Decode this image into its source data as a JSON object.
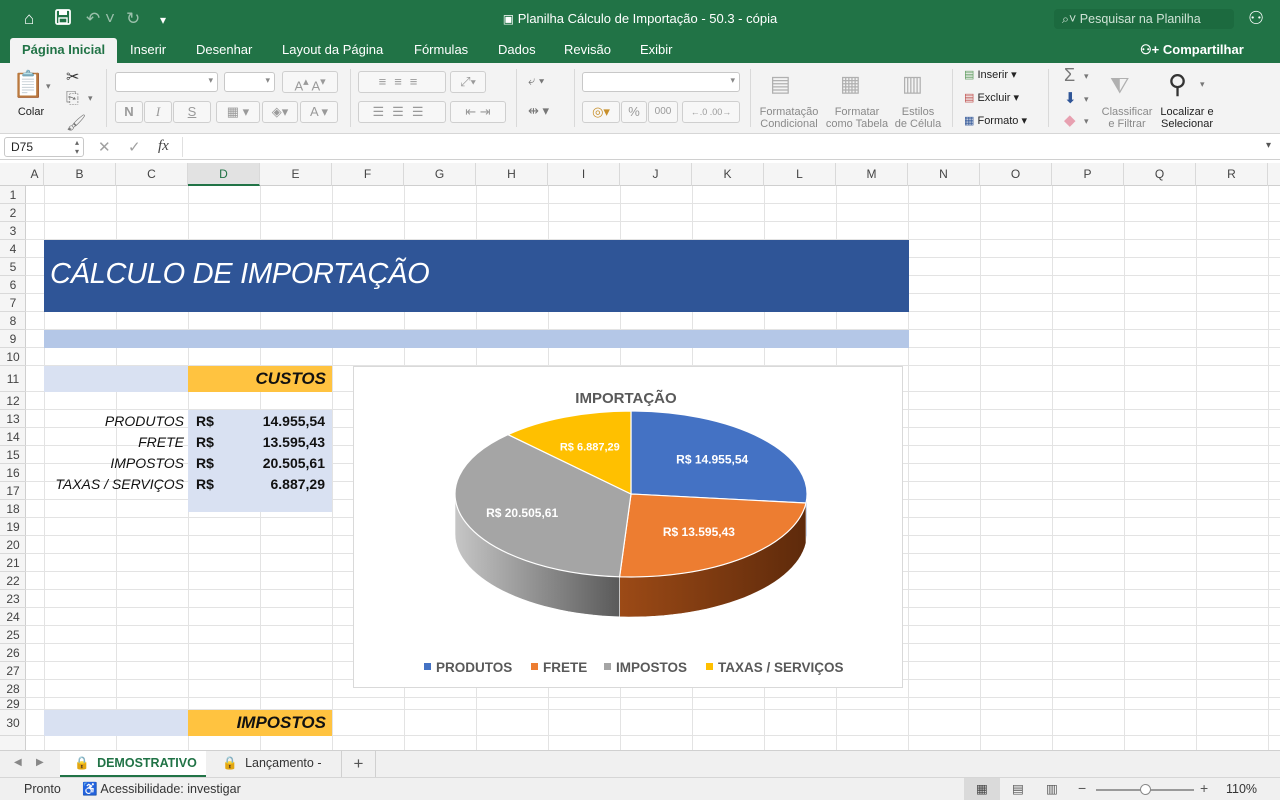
{
  "window": {
    "title": "Planilha Cálculo de Importação - 50.3 - cópia",
    "search_placeholder": "Pesquisar na Planilha"
  },
  "tabs": [
    "Página Inicial",
    "Inserir",
    "Desenhar",
    "Layout da Página",
    "Fórmulas",
    "Dados",
    "Revisão",
    "Exibir"
  ],
  "share_label": "Compartilhar",
  "ribbon": {
    "paste_label": "Colar",
    "bold": "N",
    "italic": "I",
    "underline": "S",
    "percent": "%",
    "thousands": "000",
    "conditional_format": [
      "Formatação",
      "Condicional"
    ],
    "format_table": [
      "Formatar",
      "como Tabela"
    ],
    "cell_styles": [
      "Estilos",
      "de Célula"
    ],
    "insert": "Inserir",
    "delete": "Excluir",
    "format": "Formato",
    "sort_filter": [
      "Classificar",
      "e Filtrar"
    ],
    "find_select": [
      "Localizar e",
      "Selecionar"
    ]
  },
  "formula_bar": {
    "name_box": "D75",
    "fx": "fx",
    "value": ""
  },
  "columns": [
    "A",
    "B",
    "C",
    "D",
    "E",
    "F",
    "G",
    "H",
    "I",
    "J",
    "K",
    "L",
    "M",
    "N",
    "O",
    "P",
    "Q",
    "R"
  ],
  "selected_column": "D",
  "rows": [
    "1",
    "2",
    "3",
    "4",
    "5",
    "6",
    "7",
    "8",
    "9",
    "10",
    "11",
    "12",
    "13",
    "14",
    "15",
    "16",
    "17",
    "18",
    "19",
    "20",
    "21",
    "22",
    "23",
    "24",
    "25",
    "26",
    "27",
    "28",
    "29",
    "30"
  ],
  "sheet": {
    "banner_title": "CÁLCULO DE IMPORTAÇÃO",
    "custos_header": "CUSTOS",
    "currency": "R$",
    "items": [
      {
        "label": "PRODUTOS",
        "value": "14.955,54"
      },
      {
        "label": "FRETE",
        "value": "13.595,43"
      },
      {
        "label": "IMPOSTOS",
        "value": "20.505,61"
      },
      {
        "label": "TAXAS / SERVIÇOS",
        "value": "6.887,29"
      }
    ],
    "impostos_header": "IMPOSTOS"
  },
  "chart_data": {
    "type": "pie",
    "title": "IMPORTAÇÃO",
    "categories": [
      "PRODUTOS",
      "FRETE",
      "IMPOSTOS",
      "TAXAS / SERVIÇOS"
    ],
    "values": [
      14955.54,
      13595.43,
      20505.61,
      6887.29
    ],
    "data_labels": [
      "R$ 14.955,54",
      "R$ 13.595,43",
      "R$ 20.505,61",
      "R$ 6.887,29"
    ],
    "colors": [
      "#4472c4",
      "#ed7d31",
      "#a5a5a5",
      "#ffc000"
    ],
    "legend_position": "bottom",
    "style": "3d"
  },
  "sheet_tabs": [
    {
      "label": "DEMOSTRATIVO",
      "active": true
    },
    {
      "label": "Lançamento -",
      "active": false
    }
  ],
  "add_sheet": "+",
  "status": {
    "ready": "Pronto",
    "accessibility": "Acessibilidade: investigar",
    "zoom": "110%"
  }
}
